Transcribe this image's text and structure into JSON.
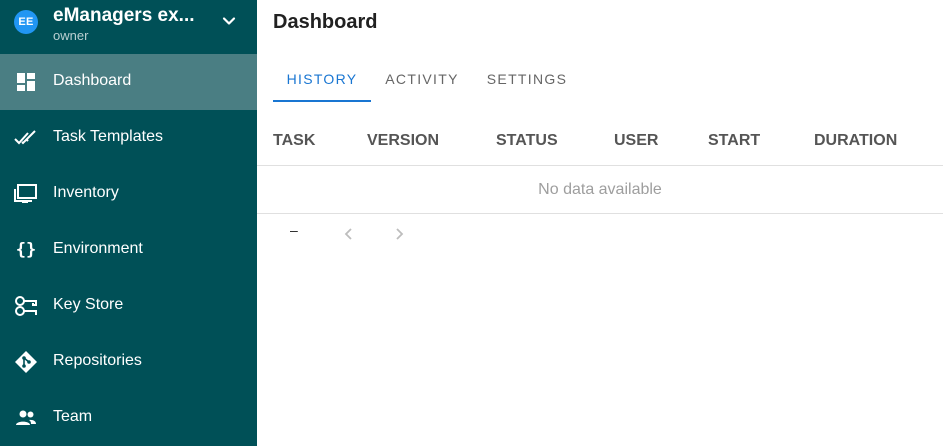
{
  "sidebar": {
    "project": {
      "avatar_initials": "EE",
      "name": "eManagers ex...",
      "role": "owner"
    },
    "items": [
      {
        "label": "Dashboard",
        "icon": "dashboard-icon",
        "active": true
      },
      {
        "label": "Task Templates",
        "icon": "double-check-icon"
      },
      {
        "label": "Inventory",
        "icon": "monitor-icon"
      },
      {
        "label": "Environment",
        "icon": "braces-icon"
      },
      {
        "label": "Key Store",
        "icon": "key-icon"
      },
      {
        "label": "Repositories",
        "icon": "git-icon"
      },
      {
        "label": "Team",
        "icon": "people-icon"
      }
    ],
    "braces_glyph": "{}"
  },
  "main": {
    "title": "Dashboard",
    "tabs": [
      {
        "label": "HISTORY",
        "active": true
      },
      {
        "label": "ACTIVITY"
      },
      {
        "label": "SETTINGS"
      }
    ],
    "table": {
      "columns": [
        "TASK",
        "VERSION",
        "STATUS",
        "USER",
        "START",
        "DURATION"
      ],
      "empty_text": "No data available"
    },
    "pagination": {
      "range_text": "–"
    }
  },
  "colors": {
    "sidebar_bg": "#005057",
    "sidebar_active": "#4a7e83",
    "accent": "#1976d2",
    "avatar": "#2196f3"
  }
}
